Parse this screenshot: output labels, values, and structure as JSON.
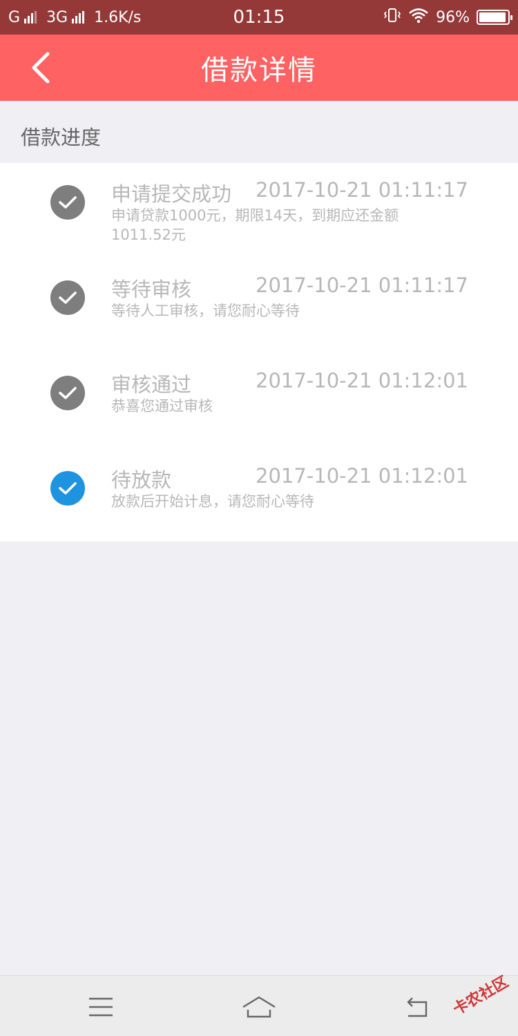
{
  "status_bar": {
    "carrier1": "G",
    "carrier2": "3G",
    "speed": "1.6K/s",
    "time": "01:15",
    "battery_percent": "96%",
    "battery_level": 0.96
  },
  "header": {
    "title": "借款详情",
    "back_icon": "chevron-left-icon"
  },
  "section": {
    "label": "借款进度"
  },
  "steps": [
    {
      "title": "申请提交成功",
      "time": "2017-10-21 01:11:17",
      "desc": "申请贷款1000元，期限14天，到期应还金额1011.52元",
      "status": "done",
      "icon": "check-circle-icon"
    },
    {
      "title": "等待审核",
      "time": "2017-10-21 01:11:17",
      "desc": "等待人工审核，请您耐心等待",
      "status": "done",
      "icon": "check-circle-icon"
    },
    {
      "title": "审核通过",
      "time": "2017-10-21 01:12:01",
      "desc": "恭喜您通过审核",
      "status": "done",
      "icon": "check-circle-icon"
    },
    {
      "title": "待放款",
      "time": "2017-10-21 01:12:01",
      "desc": "放款后开始计息，请您耐心等待",
      "status": "current",
      "icon": "check-circle-icon"
    }
  ],
  "bottom_nav": {
    "menu_icon": "menu-icon",
    "home_icon": "home-icon",
    "return_icon": "return-icon"
  },
  "watermark": {
    "text": "卡农社区"
  },
  "colors": {
    "status_bar": "#943838",
    "header": "#ff6262",
    "check_done": "#7e7e7e",
    "check_current": "#1e93e0",
    "muted_text": "#b7b7b7",
    "background": "#f0eff4"
  }
}
